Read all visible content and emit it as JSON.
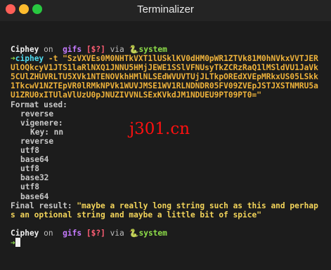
{
  "window": {
    "title": "Terminalizer"
  },
  "prompt": {
    "user": "Ciphey",
    "on": "on",
    "branch_icon": "",
    "branch": "gifs",
    "status": "[$?]",
    "via": "via",
    "env_icon": "🐍",
    "env": "system",
    "arrow": "➜"
  },
  "command": {
    "name": "ciphey",
    "args": "-t \"SzVXVEs0M0NHTkVXT1lUSklKV0dHM0pWR1ZTVk81M0hNVkxVVTJERUlOQkcyV1JTS1laRlNXQ1JNNU5HMjJEWE1SSlVFNUsyTkZCRzRaQ1lMSldVU1JaVk5CUlZHUVRLTU5XVk1NTENOVkhHMlNLSEdWVUVTUjJLTkpOREdXVEpMRkxUS05LSkk1TkcwV1NZTEpVR0lRMkNPVk1WUVJMSE1WV1RLNDNDR05FV09ZVEpJSTJXSTNMRU5aU1ZRU0xITUlaVlUzU0pJNUZIVVNLSExKVkdJM1NDUEU9PT09PT0=\""
  },
  "output": {
    "format_label": "Format used:",
    "formats": [
      {
        "text": "reverse",
        "level": 1
      },
      {
        "text": "vigenere:",
        "level": 1
      },
      {
        "text": "Key: nn",
        "level": 2
      },
      {
        "text": "reverse",
        "level": 1
      },
      {
        "text": "utf8",
        "level": 1
      },
      {
        "text": "base64",
        "level": 1
      },
      {
        "text": "utf8",
        "level": 1
      },
      {
        "text": "base32",
        "level": 1
      },
      {
        "text": "utf8",
        "level": 1
      },
      {
        "text": "base64",
        "level": 1
      }
    ],
    "final_label": "Final result: ",
    "final_result": "\"maybe a really long string such as this and perhaps an optional string and maybe a little bit of spice\""
  },
  "watermark": "j301.cn",
  "colors": {
    "background": "#1c1c1c",
    "cipher": "#efb33b",
    "result": "#f3d45a",
    "prompt_arrow": "#8ede49"
  }
}
